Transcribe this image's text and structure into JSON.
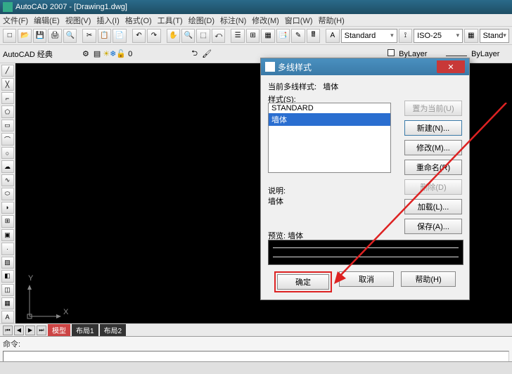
{
  "title": "AutoCAD 2007 - [Drawing1.dwg]",
  "menu": {
    "file": "文件(F)",
    "edit": "编辑(E)",
    "view": "视图(V)",
    "insert": "插入(I)",
    "format": "格式(O)",
    "tools": "工具(T)",
    "draw": "绘图(D)",
    "dimension": "标注(N)",
    "modify": "修改(M)",
    "window": "窗口(W)",
    "help": "帮助(H)"
  },
  "toolbar1": {
    "style_combo": "Standard",
    "dim_combo": "ISO-25",
    "table_combo": "Stand"
  },
  "toolbar2": {
    "workspace": "AutoCAD 经典",
    "layer": "0",
    "color": "ByLayer",
    "linetype": "ByLayer"
  },
  "viewport": {
    "y": "Y",
    "x": "X"
  },
  "tabs": {
    "model": "模型",
    "layout1": "布局1",
    "layout2": "布局2"
  },
  "command": {
    "prompt": "命令:"
  },
  "dialog": {
    "title": "多线样式",
    "current_label": "当前多线样式:",
    "current_value": "墙体",
    "styles_label": "样式(S):",
    "list": [
      "STANDARD",
      "墙体"
    ],
    "buttons": {
      "set_current": "置为当前(U)",
      "new": "新建(N)...",
      "modify": "修改(M)...",
      "rename": "重命名(R)",
      "delete": "删除(D)",
      "load": "加载(L)...",
      "save": "保存(A)..."
    },
    "desc_label": "说明:",
    "desc_value": "墙体",
    "preview_label": "预览:  墙体",
    "ok": "确定",
    "cancel": "取消",
    "help": "帮助(H)"
  }
}
